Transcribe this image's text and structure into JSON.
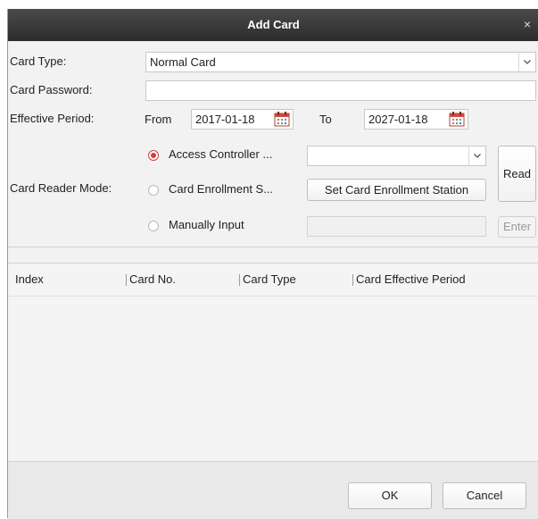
{
  "dialog": {
    "title": "Add Card",
    "close_glyph": "×"
  },
  "form": {
    "card_type_label": "Card Type:",
    "card_type_value": "Normal Card",
    "card_password_label": "Card Password:",
    "card_password_value": "",
    "effective_period_label": "Effective Period:",
    "from_label": "From",
    "from_date": "2017-01-18",
    "to_label": "To",
    "to_date": "2027-01-18",
    "card_reader_mode_label": "Card Reader Mode:"
  },
  "reader_modes": {
    "access_controller_label": "Access Controller ...",
    "card_enrollment_label": "Card Enrollment S...",
    "manually_input_label": "Manually Input",
    "selected": "access_controller",
    "access_controller_select_value": "",
    "set_station_button_label": "Set Card Enrollment Station",
    "manual_input_value": "",
    "read_button_label": "Read",
    "enter_button_label": "Enter"
  },
  "table": {
    "columns": [
      "Index",
      "Card No.",
      "Card Type",
      "Card Effective Period"
    ],
    "rows": []
  },
  "footer": {
    "ok_label": "OK",
    "cancel_label": "Cancel"
  },
  "icons": {
    "calendar": "calendar-icon",
    "dropdown": "chevron-down-icon",
    "close": "close-icon"
  },
  "colors": {
    "titlebar": "#3a3a3a",
    "radio_selected": "#d83a3a",
    "calendar_accent": "#d24a3a"
  }
}
